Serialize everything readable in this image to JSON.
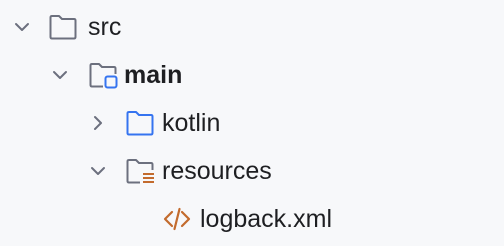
{
  "tree": {
    "items": [
      {
        "label": "src",
        "bold": false,
        "expanded": true,
        "icon": "folder-icon"
      },
      {
        "label": "main",
        "bold": true,
        "expanded": true,
        "icon": "source-root-folder-icon"
      },
      {
        "label": "kotlin",
        "bold": false,
        "expanded": false,
        "icon": "source-folder-icon"
      },
      {
        "label": "resources",
        "bold": false,
        "expanded": true,
        "icon": "resources-folder-icon"
      },
      {
        "label": "logback.xml",
        "bold": false,
        "icon": "xml-file-icon"
      }
    ]
  },
  "colors": {
    "background": "#f7f8fa",
    "text": "#1e1f22",
    "chevron": "#6c707e",
    "folder_outline": "#6c707e",
    "source_folder": "#3574f0",
    "resources_accent": "#c75450",
    "xml_icon": "#c36b2d"
  }
}
